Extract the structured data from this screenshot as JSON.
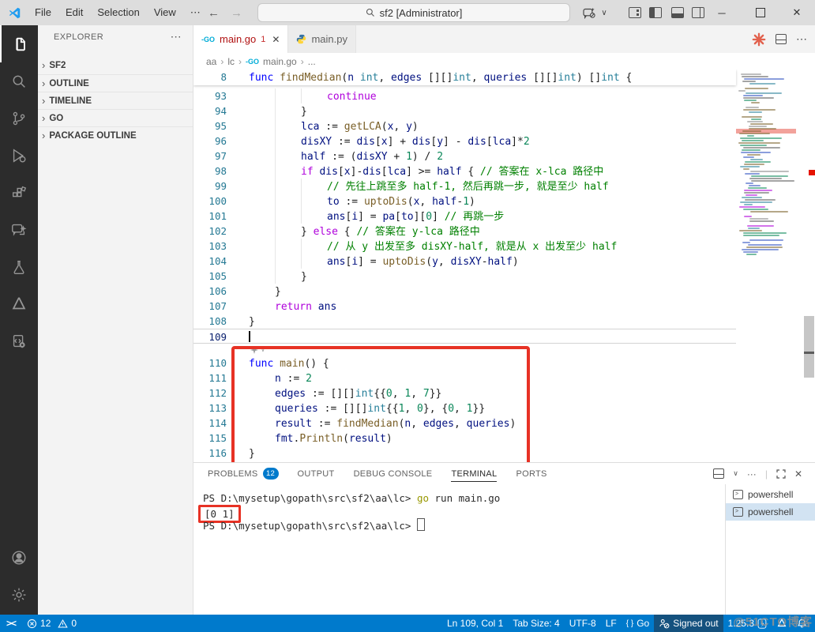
{
  "titlebar": {
    "menus": [
      "File",
      "Edit",
      "Selection",
      "View"
    ],
    "more": "⋯",
    "search_text": "sf2 [Administrator]",
    "back": "←",
    "forward": "→",
    "chevron": "∨",
    "minimize": "─",
    "close": "✕"
  },
  "tabs": {
    "tab1": {
      "label": "main.go",
      "badge": "1",
      "close": "✕"
    },
    "tab2": {
      "label": "main.py"
    },
    "go_icon": "-GO",
    "actions_more": "⋯"
  },
  "breadcrumb": {
    "items": [
      "aa",
      "lc",
      "main.go",
      "..."
    ],
    "sep": "›",
    "go_icon": "-GO"
  },
  "sidebar": {
    "title": "EXPLORER",
    "more": "⋯",
    "chevron": "›",
    "sections": [
      "SF2",
      "OUTLINE",
      "TIMELINE",
      "GO",
      "PACKAGE OUTLINE"
    ]
  },
  "code": {
    "sticky": {
      "n": "8",
      "ind": 0,
      "segs": [
        [
          "k",
          "func"
        ],
        [
          "p",
          " "
        ],
        [
          "f",
          "findMedian"
        ],
        [
          "p",
          "("
        ],
        [
          "v",
          "n"
        ],
        [
          "p",
          " "
        ],
        [
          "t",
          "int"
        ],
        [
          "p",
          ", "
        ],
        [
          "v",
          "edges"
        ],
        [
          "p",
          " [][]"
        ],
        [
          "t",
          "int"
        ],
        [
          "p",
          ", "
        ],
        [
          "v",
          "queries"
        ],
        [
          "p",
          " [][]"
        ],
        [
          "t",
          "int"
        ],
        [
          "p",
          ") []"
        ],
        [
          "t",
          "int"
        ],
        [
          "p",
          " {"
        ]
      ]
    },
    "lines": [
      {
        "n": "93",
        "ind": 3,
        "segs": [
          [
            "c",
            "continue"
          ]
        ]
      },
      {
        "n": "94",
        "ind": 2,
        "segs": [
          [
            "p",
            "}"
          ]
        ]
      },
      {
        "n": "95",
        "ind": 2,
        "segs": [
          [
            "v",
            "lca"
          ],
          [
            "p",
            " := "
          ],
          [
            "f",
            "getLCA"
          ],
          [
            "p",
            "("
          ],
          [
            "v",
            "x"
          ],
          [
            "p",
            ", "
          ],
          [
            "v",
            "y"
          ],
          [
            "p",
            ")"
          ]
        ]
      },
      {
        "n": "96",
        "ind": 2,
        "segs": [
          [
            "v",
            "disXY"
          ],
          [
            "p",
            " := "
          ],
          [
            "v",
            "dis"
          ],
          [
            "p",
            "["
          ],
          [
            "v",
            "x"
          ],
          [
            "p",
            "] + "
          ],
          [
            "v",
            "dis"
          ],
          [
            "p",
            "["
          ],
          [
            "v",
            "y"
          ],
          [
            "p",
            "] - "
          ],
          [
            "v",
            "dis"
          ],
          [
            "p",
            "["
          ],
          [
            "v",
            "lca"
          ],
          [
            "p",
            "]*"
          ],
          [
            "n",
            "2"
          ]
        ]
      },
      {
        "n": "97",
        "ind": 2,
        "segs": [
          [
            "v",
            "half"
          ],
          [
            "p",
            " := ("
          ],
          [
            "v",
            "disXY"
          ],
          [
            "p",
            " + "
          ],
          [
            "n",
            "1"
          ],
          [
            "p",
            ") / "
          ],
          [
            "n",
            "2"
          ]
        ]
      },
      {
        "n": "98",
        "ind": 2,
        "segs": [
          [
            "c",
            "if"
          ],
          [
            "p",
            " "
          ],
          [
            "v",
            "dis"
          ],
          [
            "p",
            "["
          ],
          [
            "v",
            "x"
          ],
          [
            "p",
            "]-"
          ],
          [
            "v",
            "dis"
          ],
          [
            "p",
            "["
          ],
          [
            "v",
            "lca"
          ],
          [
            "p",
            "] >= "
          ],
          [
            "v",
            "half"
          ],
          [
            "p",
            " { "
          ],
          [
            "m",
            "// 答案在 x-lca 路径中"
          ]
        ]
      },
      {
        "n": "99",
        "ind": 3,
        "segs": [
          [
            "m",
            "// 先往上跳至多 half-1, 然后再跳一步, 就是至少 half"
          ]
        ]
      },
      {
        "n": "100",
        "ind": 3,
        "segs": [
          [
            "v",
            "to"
          ],
          [
            "p",
            " := "
          ],
          [
            "f",
            "uptoDis"
          ],
          [
            "p",
            "("
          ],
          [
            "v",
            "x"
          ],
          [
            "p",
            ", "
          ],
          [
            "v",
            "half"
          ],
          [
            "p",
            "-"
          ],
          [
            "n",
            "1"
          ],
          [
            "p",
            ")"
          ]
        ]
      },
      {
        "n": "101",
        "ind": 3,
        "segs": [
          [
            "v",
            "ans"
          ],
          [
            "p",
            "["
          ],
          [
            "v",
            "i"
          ],
          [
            "p",
            "] = "
          ],
          [
            "v",
            "pa"
          ],
          [
            "p",
            "["
          ],
          [
            "v",
            "to"
          ],
          [
            "p",
            "]["
          ],
          [
            "n",
            "0"
          ],
          [
            "p",
            "] "
          ],
          [
            "m",
            "// 再跳一步"
          ]
        ]
      },
      {
        "n": "102",
        "ind": 2,
        "segs": [
          [
            "p",
            "} "
          ],
          [
            "c",
            "else"
          ],
          [
            "p",
            " { "
          ],
          [
            "m",
            "// 答案在 y-lca 路径中"
          ]
        ]
      },
      {
        "n": "103",
        "ind": 3,
        "segs": [
          [
            "m",
            "// 从 y 出发至多 disXY-half, 就是从 x 出发至少 half"
          ]
        ]
      },
      {
        "n": "104",
        "ind": 3,
        "segs": [
          [
            "v",
            "ans"
          ],
          [
            "p",
            "["
          ],
          [
            "v",
            "i"
          ],
          [
            "p",
            "] = "
          ],
          [
            "f",
            "uptoDis"
          ],
          [
            "p",
            "("
          ],
          [
            "v",
            "y"
          ],
          [
            "p",
            ", "
          ],
          [
            "v",
            "disXY"
          ],
          [
            "p",
            "-"
          ],
          [
            "v",
            "half"
          ],
          [
            "p",
            ")"
          ]
        ]
      },
      {
        "n": "105",
        "ind": 2,
        "segs": [
          [
            "p",
            "}"
          ]
        ]
      },
      {
        "n": "106",
        "ind": 1,
        "segs": [
          [
            "p",
            "}"
          ]
        ]
      },
      {
        "n": "107",
        "ind": 1,
        "segs": [
          [
            "c",
            "return"
          ],
          [
            "p",
            " "
          ],
          [
            "v",
            "ans"
          ]
        ]
      },
      {
        "n": "108",
        "ind": 0,
        "segs": [
          [
            "p",
            "}"
          ]
        ]
      },
      {
        "n": "109",
        "ind": 0,
        "cur": true,
        "cursor": true,
        "segs": []
      },
      {
        "n": "110",
        "ind": 0,
        "segs": [
          [
            "k",
            "func"
          ],
          [
            "p",
            " "
          ],
          [
            "f",
            "main"
          ],
          [
            "p",
            "() {"
          ]
        ]
      },
      {
        "n": "111",
        "ind": 1,
        "segs": [
          [
            "v",
            "n"
          ],
          [
            "p",
            " := "
          ],
          [
            "n",
            "2"
          ]
        ]
      },
      {
        "n": "112",
        "ind": 1,
        "segs": [
          [
            "v",
            "edges"
          ],
          [
            "p",
            " := [][]"
          ],
          [
            "t",
            "int"
          ],
          [
            "p",
            "{{"
          ],
          [
            "n",
            "0"
          ],
          [
            "p",
            ", "
          ],
          [
            "n",
            "1"
          ],
          [
            "p",
            ", "
          ],
          [
            "n",
            "7"
          ],
          [
            "p",
            "}}"
          ]
        ]
      },
      {
        "n": "113",
        "ind": 1,
        "segs": [
          [
            "v",
            "queries"
          ],
          [
            "p",
            " := [][]"
          ],
          [
            "t",
            "int"
          ],
          [
            "p",
            "{{"
          ],
          [
            "n",
            "1"
          ],
          [
            "p",
            ", "
          ],
          [
            "n",
            "0"
          ],
          [
            "p",
            "}, {"
          ],
          [
            "n",
            "0"
          ],
          [
            "p",
            ", "
          ],
          [
            "n",
            "1"
          ],
          [
            "p",
            "}}"
          ]
        ]
      },
      {
        "n": "114",
        "ind": 1,
        "segs": [
          [
            "v",
            "result"
          ],
          [
            "p",
            " := "
          ],
          [
            "f",
            "findMedian"
          ],
          [
            "p",
            "("
          ],
          [
            "v",
            "n"
          ],
          [
            "p",
            ", "
          ],
          [
            "v",
            "edges"
          ],
          [
            "p",
            ", "
          ],
          [
            "v",
            "queries"
          ],
          [
            "p",
            ")"
          ]
        ]
      },
      {
        "n": "115",
        "ind": 1,
        "segs": [
          [
            "v",
            "fmt"
          ],
          [
            "p",
            "."
          ],
          [
            "f",
            "Println"
          ],
          [
            "p",
            "("
          ],
          [
            "v",
            "result"
          ],
          [
            "p",
            ")"
          ]
        ]
      },
      {
        "n": "116",
        "ind": 0,
        "segs": [
          [
            "p",
            "}"
          ]
        ]
      }
    ]
  },
  "panel": {
    "tabs": [
      {
        "label": "PROBLEMS",
        "badge": "12"
      },
      {
        "label": "OUTPUT"
      },
      {
        "label": "DEBUG CONSOLE"
      },
      {
        "label": "TERMINAL",
        "active": true
      },
      {
        "label": "PORTS"
      }
    ],
    "actions": {
      "chevron": "∨",
      "more": "···",
      "close": "✕"
    },
    "terminal_lines": [
      {
        "prompt": "PS D:\\mysetup\\gopath\\src\\sf2\\aa\\lc> ",
        "command": "go",
        "rest": " run main.go"
      },
      {
        "output": "[0 1]",
        "boxed": true
      },
      {
        "prompt": "PS D:\\mysetup\\gopath\\src\\sf2\\aa\\lc> ",
        "cursor": true
      }
    ],
    "terminal_list": [
      {
        "label": "powershell",
        "selected": false
      },
      {
        "label": "powershell",
        "selected": true
      }
    ]
  },
  "status": {
    "remote": "><",
    "errors": "12",
    "warnings": "0",
    "line_col": "Ln 109, Col 1",
    "tab_size": "Tab Size: 4",
    "encoding": "UTF-8",
    "eol": "LF",
    "lang_braces": "{ }",
    "lang": "Go",
    "signed": "Signed out",
    "version": "1.25.3"
  },
  "watermark": "@51CTO博客",
  "colors": {
    "accent": "#007acc",
    "annotation": "#e73225",
    "error_file": "#b01111",
    "go_cyan": "#00acd7"
  }
}
